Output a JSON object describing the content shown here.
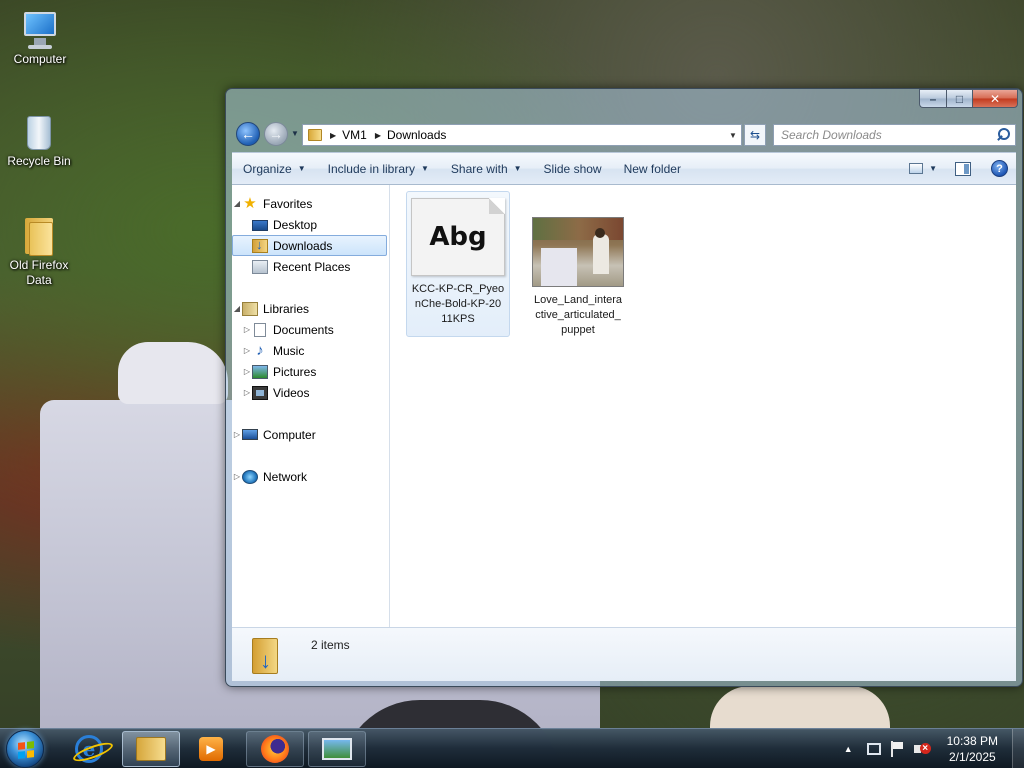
{
  "desktop": {
    "icons": [
      {
        "label": "Computer",
        "icon": "computer-icon"
      },
      {
        "label": "Recycle Bin",
        "icon": "recycle-bin-icon"
      },
      {
        "label": "Old Firefox Data",
        "icon": "folder-icon"
      }
    ]
  },
  "window": {
    "controls": {
      "minimize": "–",
      "maximize": "□",
      "close": "✕"
    },
    "address": {
      "crumbs": [
        "VM1",
        "Downloads"
      ]
    },
    "search": {
      "placeholder": "Search Downloads"
    },
    "commands": {
      "organize": "Organize",
      "include_in_library": "Include in library",
      "share_with": "Share with",
      "slide_show": "Slide show",
      "new_folder": "New folder"
    },
    "nav": {
      "favorites": "Favorites",
      "desktop": "Desktop",
      "downloads": "Downloads",
      "recent_places": "Recent Places",
      "libraries": "Libraries",
      "documents": "Documents",
      "music": "Music",
      "pictures": "Pictures",
      "videos": "Videos",
      "computer": "Computer",
      "network": "Network"
    },
    "files": [
      {
        "name": "KCC-KP-CR_PyeonChe-Bold-KP-2011KPS",
        "name_lines": [
          "KCC-KP-CR_Pyeo",
          "nChe-Bold-KP-20",
          "11KPS"
        ],
        "type": "font",
        "preview": "Abg"
      },
      {
        "name": "Love_Land_interactive_articulated_puppet",
        "name_lines": [
          "Love_Land_intera",
          "ctive_articulated_",
          "puppet"
        ],
        "type": "image"
      }
    ],
    "details": {
      "count": "2 items"
    }
  },
  "taskbar": {
    "buttons": [
      {
        "name": "internet-explorer",
        "state": "pinned"
      },
      {
        "name": "windows-explorer",
        "state": "active"
      },
      {
        "name": "media-player",
        "state": "pinned"
      },
      {
        "name": "firefox",
        "state": "running"
      },
      {
        "name": "photo-viewer",
        "state": "running"
      }
    ],
    "clock": {
      "time": "10:38 PM",
      "date": "2/1/2025"
    }
  },
  "colors": {
    "accent": "#1e395b",
    "selection": "#cce4fb",
    "close": "#c2391e"
  }
}
